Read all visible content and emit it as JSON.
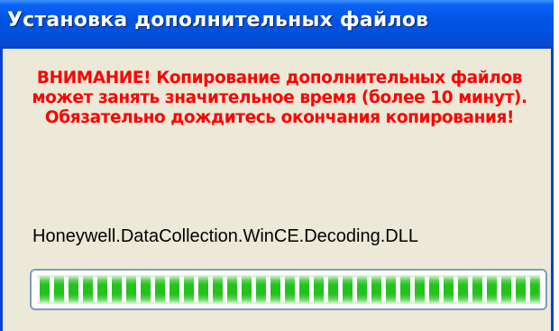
{
  "window": {
    "title": "Установка дополнительных файлов"
  },
  "warning_text": "ВНИМАНИЕ! Копирование дополнительных файлов может занять значительное время (более 10 минут). Обязательно дождитесь окончания копирования!",
  "current_file": "Honeywell.DataCollection.WinCE.Decoding.DLL",
  "progress": {
    "fraction": 1.0
  },
  "colors": {
    "titlebar": "#0054e3",
    "title_text": "#ffffff",
    "background": "#ece9d8",
    "warning_text": "#ff0000",
    "progress_fill": "#24c21c",
    "progress_border": "#7f9db9"
  }
}
